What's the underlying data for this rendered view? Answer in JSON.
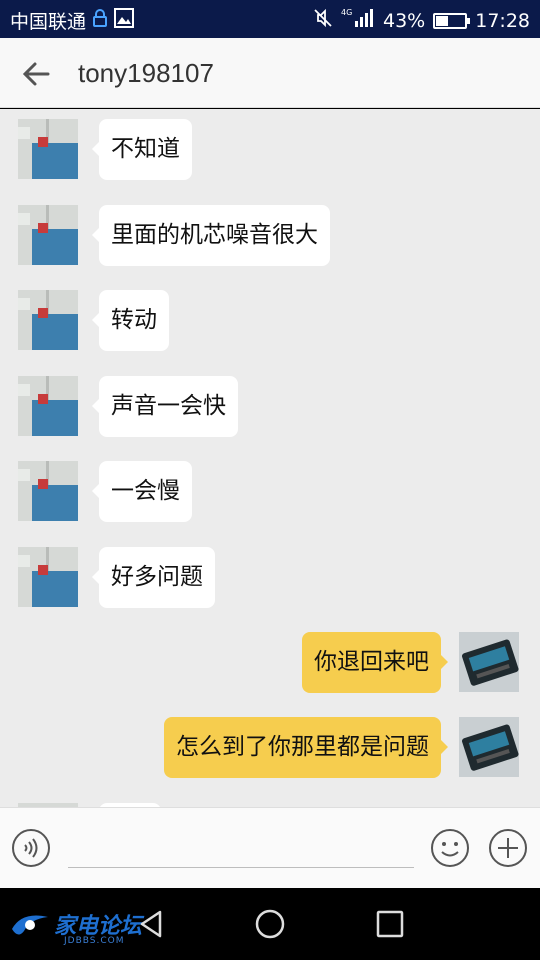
{
  "status_bar": {
    "carrier": "中国联通",
    "battery_percent": "43%",
    "battery_level": 0.43,
    "time": "17:28",
    "network": "4G"
  },
  "header": {
    "title": "tony198107"
  },
  "messages": [
    {
      "side": "in",
      "text": "不知道"
    },
    {
      "side": "in",
      "text": "里面的机芯噪音很大"
    },
    {
      "side": "in",
      "text": "转动"
    },
    {
      "side": "in",
      "text": "声音一会快"
    },
    {
      "side": "in",
      "text": "一会慢"
    },
    {
      "side": "in",
      "text": "好多问题"
    },
    {
      "side": "out",
      "text": "你退回来吧"
    },
    {
      "side": "out",
      "text": "怎么到了你那里都是问题"
    }
  ],
  "input": {
    "value": "",
    "placeholder": ""
  },
  "watermark": {
    "text": "家电论坛",
    "sub": "JDBBS.COM"
  },
  "colors": {
    "status_bar_bg": "#0b1a4a",
    "chat_bg": "#ececec",
    "incoming_bubble": "#ffffff",
    "outgoing_bubble": "#f6cd4e"
  },
  "icons": {
    "back": "arrow-left-icon",
    "voice": "voice-icon",
    "emoji": "smiley-icon",
    "plus": "plus-icon",
    "nav_back": "triangle-back-icon",
    "nav_home": "circle-home-icon",
    "nav_recent": "square-recent-icon"
  }
}
